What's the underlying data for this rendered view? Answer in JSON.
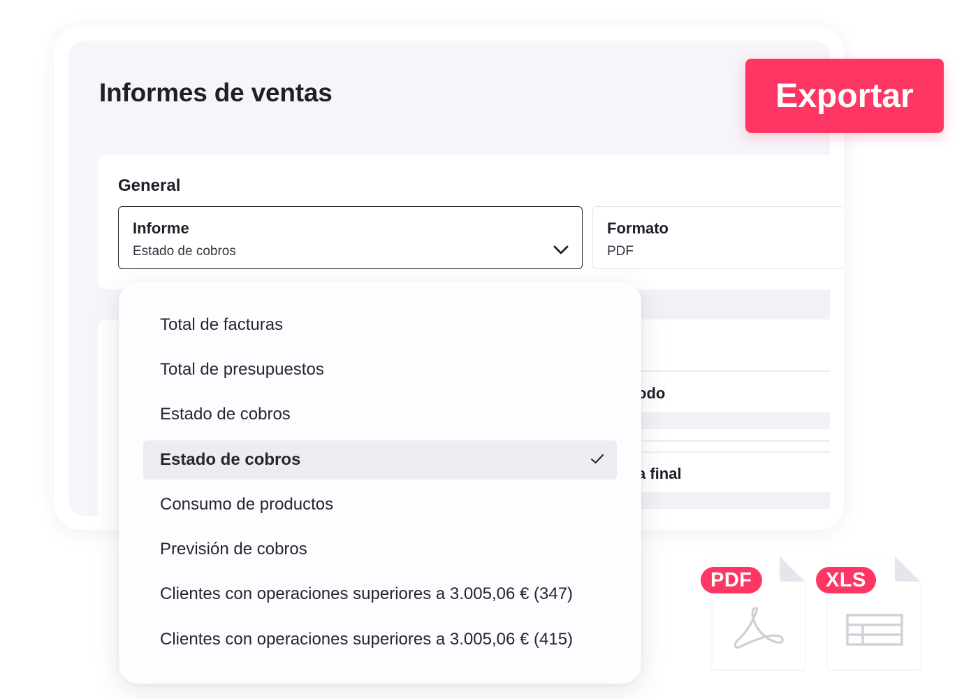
{
  "page": {
    "title": "Informes de ventas"
  },
  "export_button": {
    "label": "Exportar"
  },
  "general": {
    "title": "General",
    "report_field": {
      "label": "Informe",
      "value": "Estado de cobros",
      "icon": "chevron-down-icon"
    },
    "format_field": {
      "label": "Formato",
      "value": "PDF"
    }
  },
  "background_fields": {
    "period_label_fragment": "odo",
    "end_date_label_fragment": "a final"
  },
  "dropdown": {
    "options": [
      {
        "label": "Total de facturas",
        "selected": false
      },
      {
        "label": "Total de presupuestos",
        "selected": false
      },
      {
        "label": "Estado de cobros",
        "selected": false
      },
      {
        "label": "Estado de cobros",
        "selected": true
      },
      {
        "label": "Consumo de productos",
        "selected": false
      },
      {
        "label": "Previsión de cobros",
        "selected": false
      },
      {
        "label": "Clientes con operaciones superiores a 3.005,06 € (347)",
        "selected": false
      },
      {
        "label": "Clientes con operaciones superiores a 3.005,06 € (415)",
        "selected": false
      }
    ]
  },
  "file_types": {
    "pdf": {
      "badge": "PDF",
      "icon": "pdf-acrobat-icon"
    },
    "xls": {
      "badge": "XLS",
      "icon": "spreadsheet-table-icon"
    }
  },
  "colors": {
    "accent": "#fe3663",
    "panel_bg": "#f6f5fa",
    "selected_bg": "#ececf3",
    "text": "#1f1f2a"
  }
}
